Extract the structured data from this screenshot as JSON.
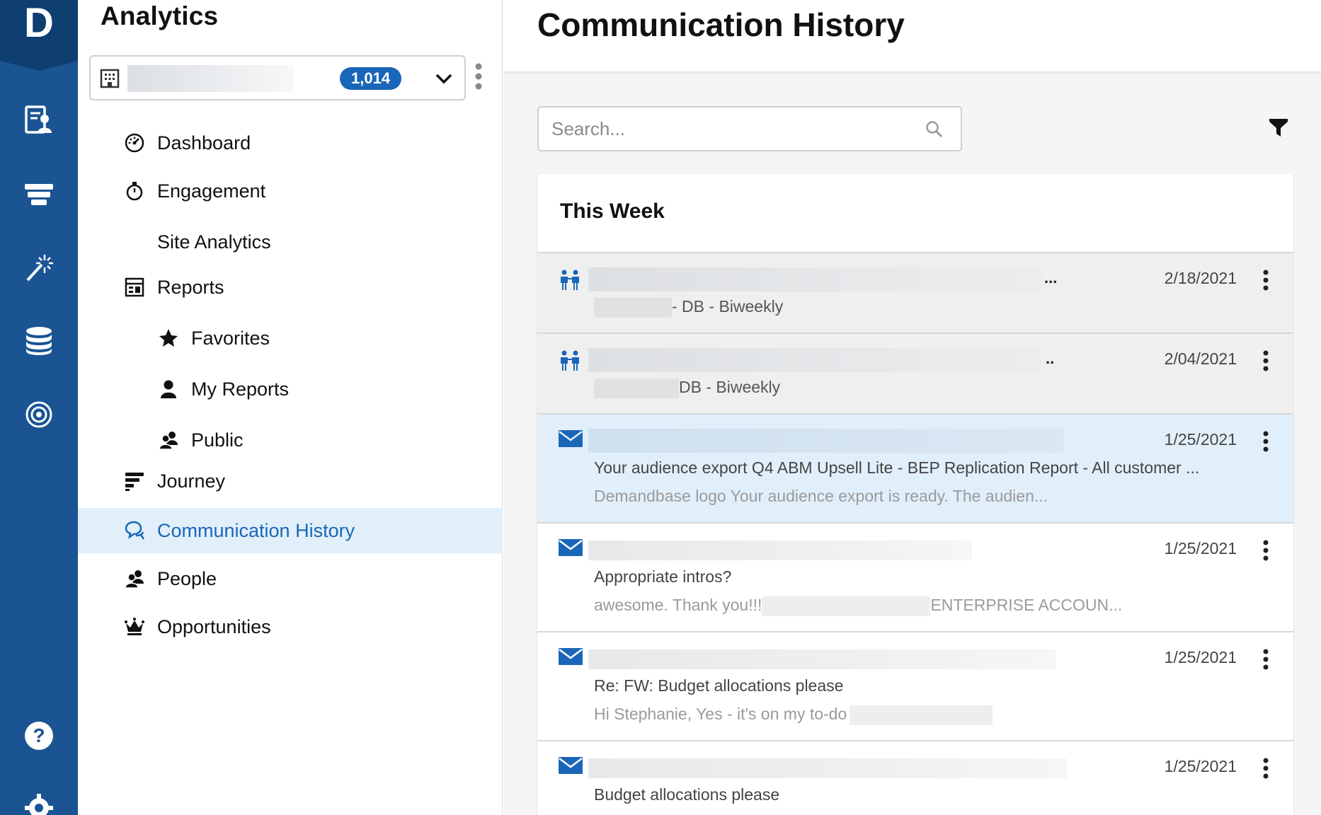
{
  "rail": {
    "logo_letter": "D",
    "icons": [
      "account-report-icon",
      "funnel-icon",
      "magic-wand-icon",
      "database-icon",
      "target-icon",
      "help-icon",
      "settings-icon"
    ]
  },
  "sidebar": {
    "title": "Analytics",
    "account_count": "1,014",
    "nav": [
      {
        "label": "Dashboard",
        "icon": "gauge-icon"
      },
      {
        "label": "Engagement",
        "icon": "stopwatch-icon"
      },
      {
        "label": "Site Analytics",
        "icon": ""
      },
      {
        "label": "Reports",
        "icon": "calendar-report-icon"
      },
      {
        "label": "Favorites",
        "icon": "star-icon"
      },
      {
        "label": "My Reports",
        "icon": "user-icon"
      },
      {
        "label": "Public",
        "icon": "users-icon"
      },
      {
        "label": "Journey",
        "icon": "journey-bars-icon"
      },
      {
        "label": "Communication History",
        "icon": "chat-bubbles-icon",
        "active": true
      },
      {
        "label": "People",
        "icon": "people-icon"
      },
      {
        "label": "Opportunities",
        "icon": "crown-icon"
      }
    ]
  },
  "main": {
    "title": "Communication History",
    "search_placeholder": "Search...",
    "section_title": "This Week",
    "items": [
      {
        "type": "meeting",
        "date": "2/18/2021",
        "ellipsis": "...",
        "line2_suffix": "- DB - Biweekly"
      },
      {
        "type": "meeting",
        "date": "2/04/2021",
        "ellipsis": "..",
        "line2_suffix": "DB - Biweekly"
      },
      {
        "type": "email",
        "date": "1/25/2021",
        "subject": "Your audience export Q4 ABM Upsell Lite - BEP Replication Report - All customer ...",
        "preview": "Demandbase logo Your audience export is ready. The audien..."
      },
      {
        "type": "email",
        "date": "1/25/2021",
        "subject": "Appropriate intros?",
        "preview_start": "awesome. Thank you!!!",
        "preview_end": "ENTERPRISE ACCOUN..."
      },
      {
        "type": "email",
        "date": "1/25/2021",
        "subject": "Re: FW: Budget allocations please",
        "preview": "Hi Stephanie, Yes - it's on my to-do"
      },
      {
        "type": "email",
        "date": "1/25/2021",
        "subject": "Budget allocations please"
      }
    ]
  },
  "colors": {
    "rail": "#1a5493",
    "accent": "#1a66b8",
    "active_bg": "#e1effa"
  }
}
